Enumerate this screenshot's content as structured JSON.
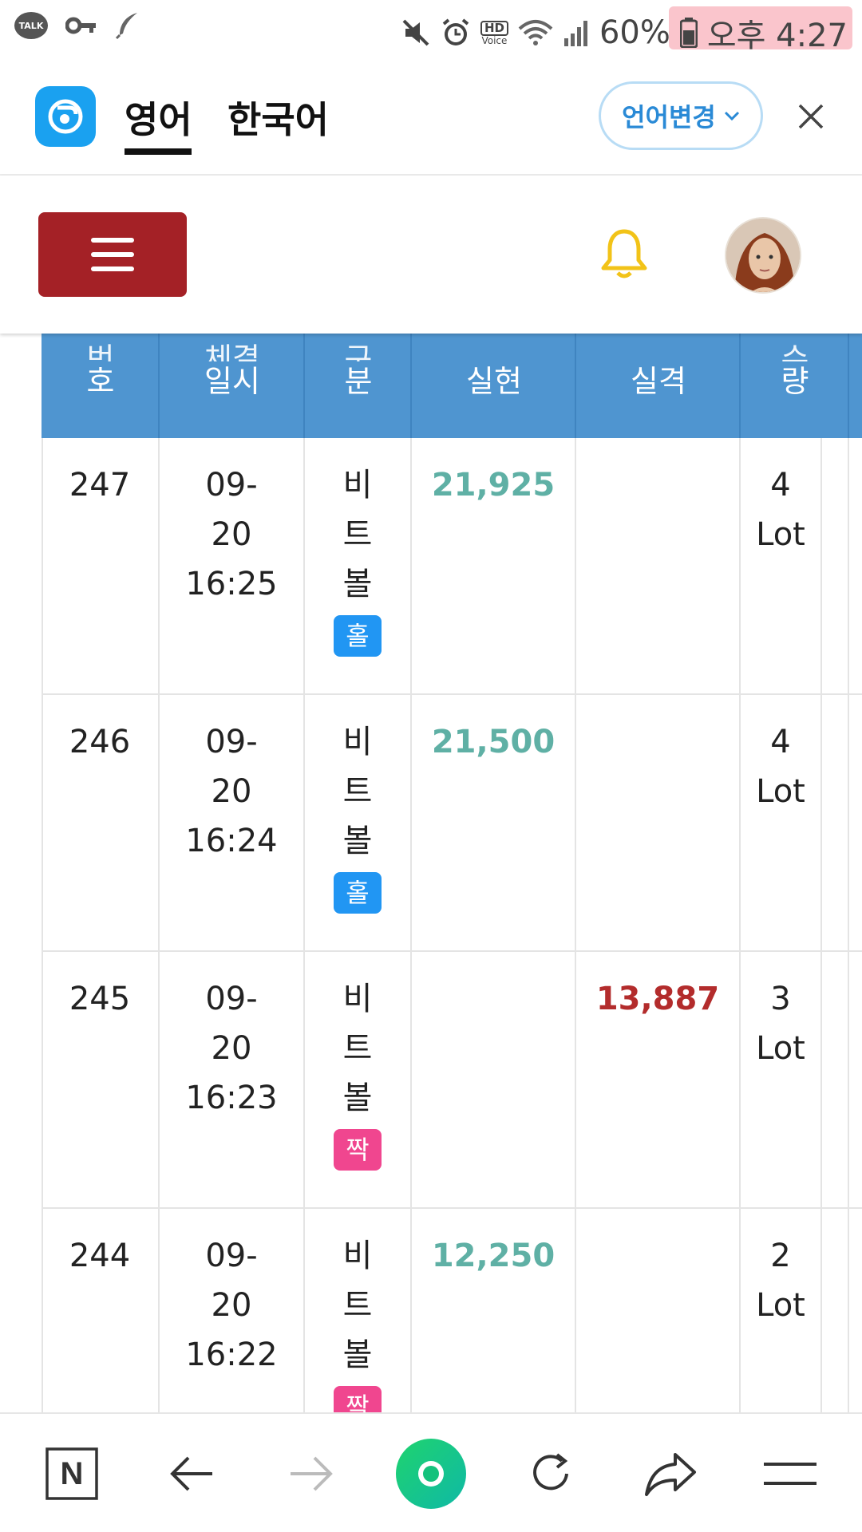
{
  "status_bar": {
    "talk_label": "TALK",
    "hd_label": "HD",
    "voice_label": "Voice",
    "battery": "60%",
    "time": "오후 4:27",
    "icons": [
      "kakaotalk-icon",
      "key-icon",
      "feather-icon",
      "mute-icon",
      "alarm-icon",
      "wifi-icon",
      "signal-icon",
      "battery-icon"
    ]
  },
  "translate_bar": {
    "tabs": [
      {
        "label": "영어",
        "active": true
      },
      {
        "label": "한국어",
        "active": false
      }
    ],
    "change_language": "언어변경",
    "accent": "#1aa1f0"
  },
  "header": {
    "menu_color": "#a42126",
    "bell_color": "#f2c318"
  },
  "table": {
    "headers": [
      {
        "top": "번",
        "bottom": "호"
      },
      {
        "top": "체결",
        "bottom": "일시"
      },
      {
        "top": "구",
        "bottom": "분"
      },
      {
        "top": "",
        "bottom": "실현"
      },
      {
        "top": "",
        "bottom": "실격"
      },
      {
        "top": "수",
        "bottom": "량"
      }
    ],
    "rows": [
      {
        "no": "247",
        "date": "09-",
        "day": "20",
        "time": "16:25",
        "kind": [
          "비",
          "트",
          "볼"
        ],
        "tag": "홀",
        "tag_color": "blue",
        "win": "21,925",
        "loss": "",
        "qty": "4",
        "unit": "Lot"
      },
      {
        "no": "246",
        "date": "09-",
        "day": "20",
        "time": "16:24",
        "kind": [
          "비",
          "트",
          "볼"
        ],
        "tag": "홀",
        "tag_color": "blue",
        "win": "21,500",
        "loss": "",
        "qty": "4",
        "unit": "Lot"
      },
      {
        "no": "245",
        "date": "09-",
        "day": "20",
        "time": "16:23",
        "kind": [
          "비",
          "트",
          "볼"
        ],
        "tag": "짝",
        "tag_color": "pink",
        "win": "",
        "loss": "13,887",
        "qty": "3",
        "unit": "Lot"
      },
      {
        "no": "244",
        "date": "09-",
        "day": "20",
        "time": "16:22",
        "kind": [
          "비",
          "트",
          "볼"
        ],
        "tag": "짝",
        "tag_color": "pink",
        "win": "12,250",
        "loss": "",
        "qty": "2",
        "unit": "Lot"
      }
    ],
    "colors": {
      "header_bg": "#4f95d0",
      "win": "#5fb0a5",
      "loss": "#b32c2c",
      "odd_tag": "#2196f3",
      "even_tag": "#f0468f"
    }
  },
  "bottom_nav": {
    "items": [
      "naver-n-icon",
      "back-arrow-icon",
      "forward-arrow-icon",
      "green-dot-icon",
      "reload-icon",
      "share-icon",
      "menu-icon"
    ],
    "naver_label": "N",
    "green": "#1fcf6a"
  }
}
